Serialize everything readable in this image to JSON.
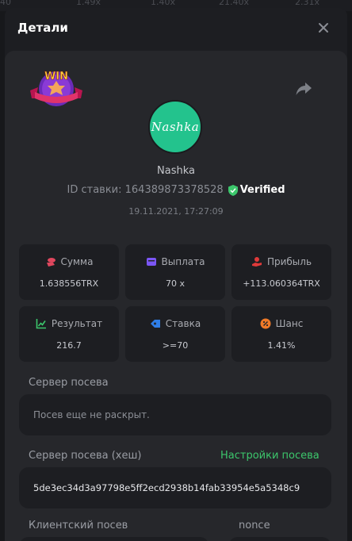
{
  "background": {
    "strip_values": [
      "1.49x",
      "1.40x",
      "21.40x",
      "2.31x"
    ]
  },
  "modal": {
    "title": "Детали"
  },
  "profile": {
    "username": "Nashka",
    "avatar_text": "Nashka",
    "avatar_color": "#23c38d",
    "bet_id": "ID ставки: 164389873378528",
    "verified_label": "Verified",
    "timestamp": "19.11.2021, 17:27:09",
    "badge_text": "WIN"
  },
  "stats": [
    {
      "label": "Сумма",
      "value": "1.638556TRX",
      "icon": "coins-icon",
      "color": "#e0475e"
    },
    {
      "label": "Выплата",
      "value": "70 x",
      "icon": "wallet-icon",
      "color": "#7b56f5"
    },
    {
      "label": "Прибыль",
      "value": "+113.060364TRX",
      "icon": "hand-coin-icon",
      "color": "#e03a3a"
    },
    {
      "label": "Результат",
      "value": "216.7",
      "icon": "chart-icon",
      "color": "#3cc76c"
    },
    {
      "label": "Ставка",
      "value": ">=70",
      "icon": "tag-icon",
      "color": "#2f7ee8"
    },
    {
      "label": "Шанс",
      "value": "1.41%",
      "icon": "percent-icon",
      "color": "#f07a28"
    }
  ],
  "seed": {
    "server_label": "Сервер посева",
    "server_placeholder": "Посев еще не раскрыт.",
    "server_hash_label": "Сервер посева (хеш)",
    "settings_link": "Настройки посева",
    "server_hash_value": "5de3ec34d3a97798e5ff2ecd2938b14fab33954e5a5348c9",
    "client_label": "Клиентский посев",
    "nonce_label": "nonce"
  },
  "colors": {
    "accent_green": "#3cc76c"
  }
}
